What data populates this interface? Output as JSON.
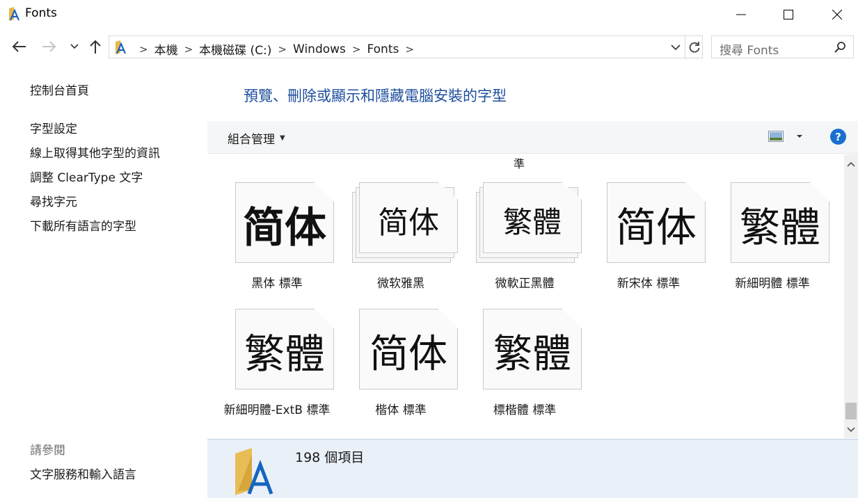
{
  "window": {
    "title": "Fonts"
  },
  "address": {
    "crumbs": [
      "本機",
      "本機磁碟 (C:)",
      "Windows",
      "Fonts"
    ]
  },
  "search": {
    "placeholder": "搜尋 Fonts"
  },
  "left_pane": {
    "home": "控制台首頁",
    "links": [
      "字型設定",
      "線上取得其他字型的資訊",
      "調整 ClearType 文字",
      "尋找字元",
      "下載所有語言的字型"
    ],
    "see_also_heading": "請參閱",
    "see_also_links": [
      "文字服務和輸入語言"
    ]
  },
  "main": {
    "heading": "預覽、刪除或顯示和隱藏電腦安裝的字型",
    "organize_label": "組合管理",
    "partial_label_above": "準"
  },
  "fonts": [
    {
      "label": "黑体 標準",
      "sample": "简体",
      "stacked": false
    },
    {
      "label": "微软雅黑",
      "sample": "简体",
      "stacked": true
    },
    {
      "label": "微軟正黑體",
      "sample": "繁體",
      "stacked": true
    },
    {
      "label": "新宋体 標準",
      "sample": "简体",
      "stacked": false
    },
    {
      "label": "新細明體 標準",
      "sample": "繁體",
      "stacked": false
    },
    {
      "label": "新細明體-ExtB 標準",
      "sample": "繁體",
      "stacked": false
    },
    {
      "label": "楷体 標準",
      "sample": "简体",
      "stacked": false
    },
    {
      "label": "標楷體 標準",
      "sample": "繁體",
      "stacked": false
    }
  ],
  "details": {
    "item_count": "198 個項目"
  },
  "colors": {
    "accent": "#1e4e9d",
    "help": "#1a6fd1",
    "details_bg": "#eaf0f8"
  }
}
